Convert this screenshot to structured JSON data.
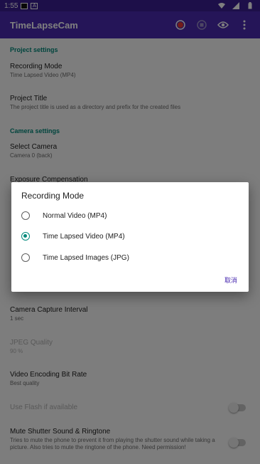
{
  "status": {
    "time": "1:55"
  },
  "appbar": {
    "title": "TimeLapseCam",
    "icons": [
      "record-icon",
      "stop-icon",
      "eye-icon",
      "more-vert-icon"
    ]
  },
  "prefs": {
    "cat_project": "Project settings",
    "recording_mode_title": "Recording Mode",
    "recording_mode_summary": "Time Lapsed Video (MP4)",
    "project_title": "Project Title",
    "project_title_summary": "The project title is used as a directory and prefix for the created files",
    "cat_camera": "Camera settings",
    "select_camera_title": "Select Camera",
    "select_camera_summary": "Camera 0 (back)",
    "exposure_title": "Exposure Compensation",
    "capture_interval_title": "Camera Capture Interval",
    "capture_interval_summary": "1 sec",
    "jpeg_quality_title": "JPEG Quality",
    "jpeg_quality_summary": "90 %",
    "bitrate_title": "Video Encoding Bit Rate",
    "bitrate_summary": "Best quality",
    "flash_title": "Use Flash if available",
    "mute_title": "Mute Shutter Sound & Ringtone",
    "mute_summary": "Tries to mute the phone to prevent it from playing the shutter sound while taking a picture. Also tries to mute the ringtone of the phone. Need permission!"
  },
  "dialog": {
    "title": "Recording Mode",
    "options": [
      {
        "label": "Normal Video (MP4)",
        "selected": false
      },
      {
        "label": "Time Lapsed Video (MP4)",
        "selected": true
      },
      {
        "label": "Time Lapsed Images (JPG)",
        "selected": false
      }
    ],
    "cancel_label": "取消"
  },
  "colors": {
    "primary": "#4a2bb0",
    "primary_dark": "#3a1f92",
    "accent": "#00897b"
  }
}
